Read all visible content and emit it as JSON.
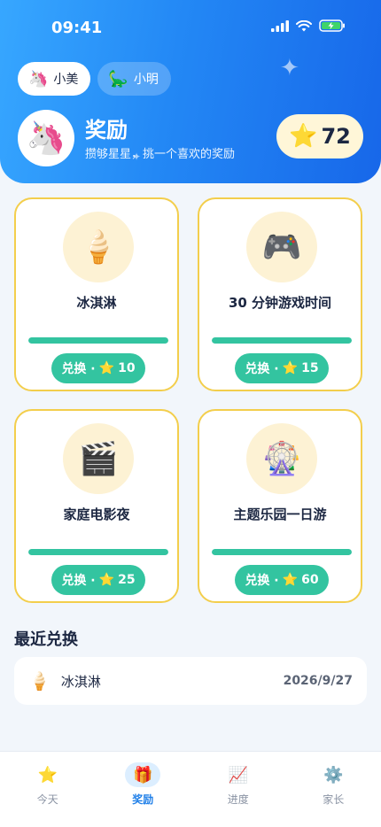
{
  "status_bar": {
    "time": "09:41"
  },
  "kids": [
    {
      "name": "小美",
      "emoji": "🦄",
      "active": true
    },
    {
      "name": "小明",
      "emoji": "🦕",
      "active": false
    }
  ],
  "header": {
    "avatar_emoji": "🦄",
    "title": "奖励",
    "subtitle": "攒够星星，挑一个喜欢的奖励",
    "star_count": "72"
  },
  "rewards": [
    {
      "title": "冰淇淋",
      "icon": "🍦",
      "icon_name": "ice-cream-icon",
      "button_label": "兑换 · ",
      "cost": "10",
      "progress": 1.0
    },
    {
      "title": "30 分钟游戏时间",
      "icon": "🎮",
      "icon_name": "game-controller-icon",
      "button_label": "兑换 · ",
      "cost": "15",
      "progress": 1.0
    },
    {
      "title": "家庭电影夜",
      "icon": "🎬",
      "icon_name": "clapperboard-icon",
      "button_label": "兑换 · ",
      "cost": "25",
      "progress": 1.0
    },
    {
      "title": "主题乐园一日游",
      "icon": "🎡",
      "icon_name": "ferris-wheel-icon",
      "button_label": "兑换 · ",
      "cost": "60",
      "progress": 1.0
    }
  ],
  "recent": {
    "title": "最近兑换",
    "items": [
      {
        "icon": "🍦",
        "name": "冰淇淋",
        "date": "2026/9/27"
      }
    ]
  },
  "nav": [
    {
      "label": "今天",
      "icon": "⭐",
      "icon_name": "star-icon",
      "active": false
    },
    {
      "label": "奖励",
      "icon": "🎁",
      "icon_name": "gift-icon",
      "active": true
    },
    {
      "label": "进度",
      "icon": "📈",
      "icon_name": "chart-icon",
      "active": false
    },
    {
      "label": "家长",
      "icon": "⚙️",
      "icon_name": "gear-icon",
      "active": false
    }
  ],
  "colors": {
    "header_blue": "#2388f5",
    "accent_green": "#33c4a0",
    "card_border_gold": "#f3ce4c",
    "star_gold": "#f7b924"
  }
}
